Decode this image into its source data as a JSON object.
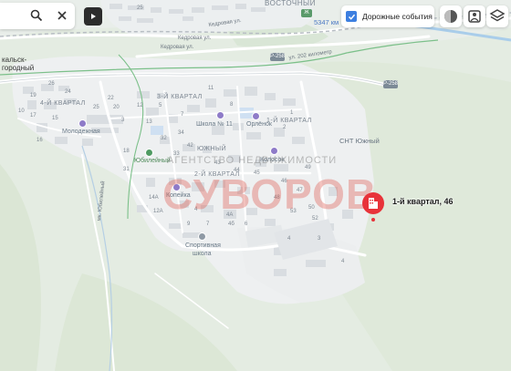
{
  "topbar": {
    "search_icon": "search-icon",
    "close_icon": "close-icon",
    "play_icon": "play-icon",
    "traffic_label": "Дорожные события",
    "traffic_checked": true,
    "layer_icons": [
      "map-style-icon",
      "panorama-icon",
      "layers-icon"
    ]
  },
  "marker": {
    "label": "1-й квартал, 46",
    "color": "#e8333a"
  },
  "watermark": {
    "line1": "АГЕНТСТВО НЕДВИЖИМОСТИ",
    "line2": "СУВОРОВ"
  },
  "places": {
    "vostochny": "ВОСТОЧНЫЙ",
    "km5347": "5347 км",
    "kedrovaya": "Кедровая ул.",
    "kedrovaya2": "Кедровая ул.",
    "kedrovaya3": "Кедровая ул.",
    "ul202": "ул. 202 километр",
    "p258": "Р-258",
    "p258b": "Р-258",
    "kalsk": "кальск-",
    "gorodny": "городный",
    "kv4": "4-Й КВАРТАЛ",
    "kv3": "3-Й КВАРТАЛ",
    "kv1": "1-Й КВАРТАЛ",
    "kv2": "2-Й КВАРТАЛ",
    "yuzhny": "ЮЖНЫЙ",
    "snt": "СНТ Южный",
    "molodezhnaya": "Молодежная",
    "shkola11": "Школа № 11",
    "orlenok": "Орлёнок",
    "yubileyny": "Юбилейный",
    "kolosok": "Колосок",
    "kopeyka": "Копейка",
    "sport1": "Спортивная",
    "sport2": "школа",
    "mikrorayon": "мк. Юбилейный"
  },
  "numbers": [
    "26",
    "24",
    "19",
    "17",
    "10",
    "15",
    "16",
    "20",
    "25",
    "22",
    "12",
    "13",
    "3",
    "5",
    "7",
    "8",
    "1",
    "2",
    "11",
    "32",
    "34",
    "42",
    "33",
    "43",
    "44",
    "45",
    "46",
    "47",
    "48",
    "49",
    "50",
    "18",
    "31",
    "14A",
    "4",
    "4A",
    "6",
    "4б",
    "7",
    "9",
    "12A",
    "53",
    "52",
    "4",
    "3",
    "4",
    "25"
  ]
}
